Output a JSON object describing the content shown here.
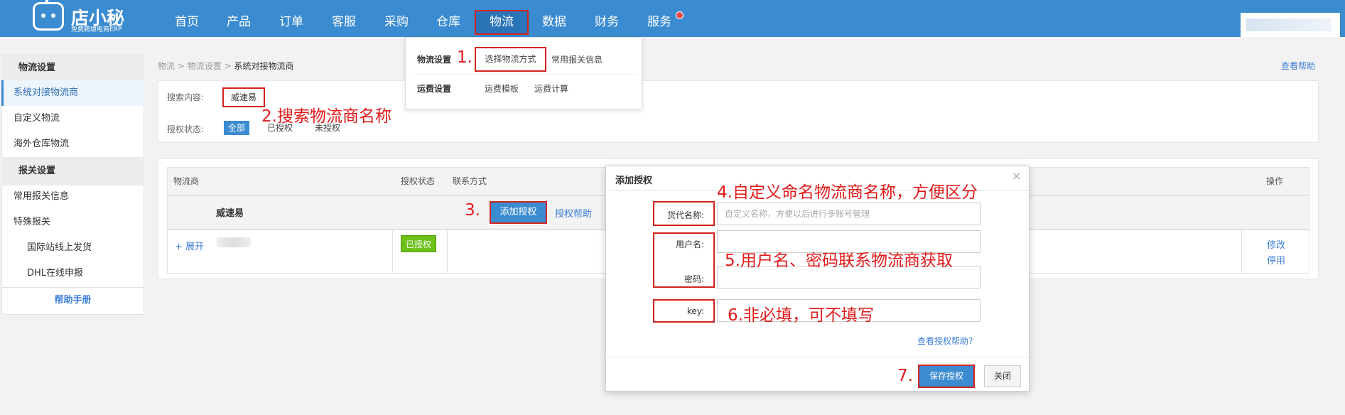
{
  "header": {
    "logo_name": "店小秘",
    "logo_sub": "免费跨境电商ERP",
    "nav": [
      "首页",
      "产品",
      "订单",
      "客服",
      "采购",
      "仓库",
      "物流",
      "数据",
      "财务",
      "服务"
    ]
  },
  "sidebar": {
    "group1": "物流设置",
    "items1": [
      "系统对接物流商",
      "自定义物流",
      "海外仓库物流"
    ],
    "group2": "报关设置",
    "items2": [
      "常用报关信息",
      "特殊报关",
      "国际站线上发货",
      "DHL在线申报"
    ],
    "manual": "帮助手册"
  },
  "breadcrumb": {
    "a": "物流",
    "b": "物流设置",
    "c": "系统对接物流商",
    "sep": ">"
  },
  "help_link": "查看帮助",
  "search": {
    "label": "搜索内容:",
    "value": "威速易",
    "auth_label": "授权状态:",
    "filters": [
      "全部",
      "已授权",
      "未授权"
    ]
  },
  "table": {
    "headers": [
      "物流商",
      "授权状态",
      "联系方式",
      "操作"
    ],
    "row_provider": "威速易",
    "add_auth": "添加授权",
    "auth_help": "授权帮助",
    "expand": "+ 展开",
    "status_badge": "已授权",
    "ops": [
      "修改",
      "停用"
    ]
  },
  "dropdown": {
    "group1": "物流设置",
    "items1": [
      "选择物流方式",
      "常用报关信息"
    ],
    "group2": "运费设置",
    "items2": [
      "运费模板",
      "运费计算"
    ]
  },
  "modal": {
    "title": "添加授权",
    "close": "×",
    "name_label": "货代名称:",
    "name_placeholder": "自定义名称，方便以后进行多账号管理",
    "user_label": "用户名:",
    "pwd_label": "密码:",
    "key_label": "key:",
    "help": "查看授权帮助?",
    "save": "保存授权",
    "cancel": "关闭"
  },
  "annotations": {
    "a1": "1.",
    "a2": "2.搜索物流商名称",
    "a3": "3.",
    "a4": "4.自定义命名物流商名称，方便区分",
    "a5": "5.用户名、密码联系物流商获取",
    "a6": "6.非必填，可不填写",
    "a7": "7."
  },
  "colors": {
    "primary": "#3b8bd0",
    "annotation_red": "#e11b1b",
    "success": "#6cc018"
  }
}
